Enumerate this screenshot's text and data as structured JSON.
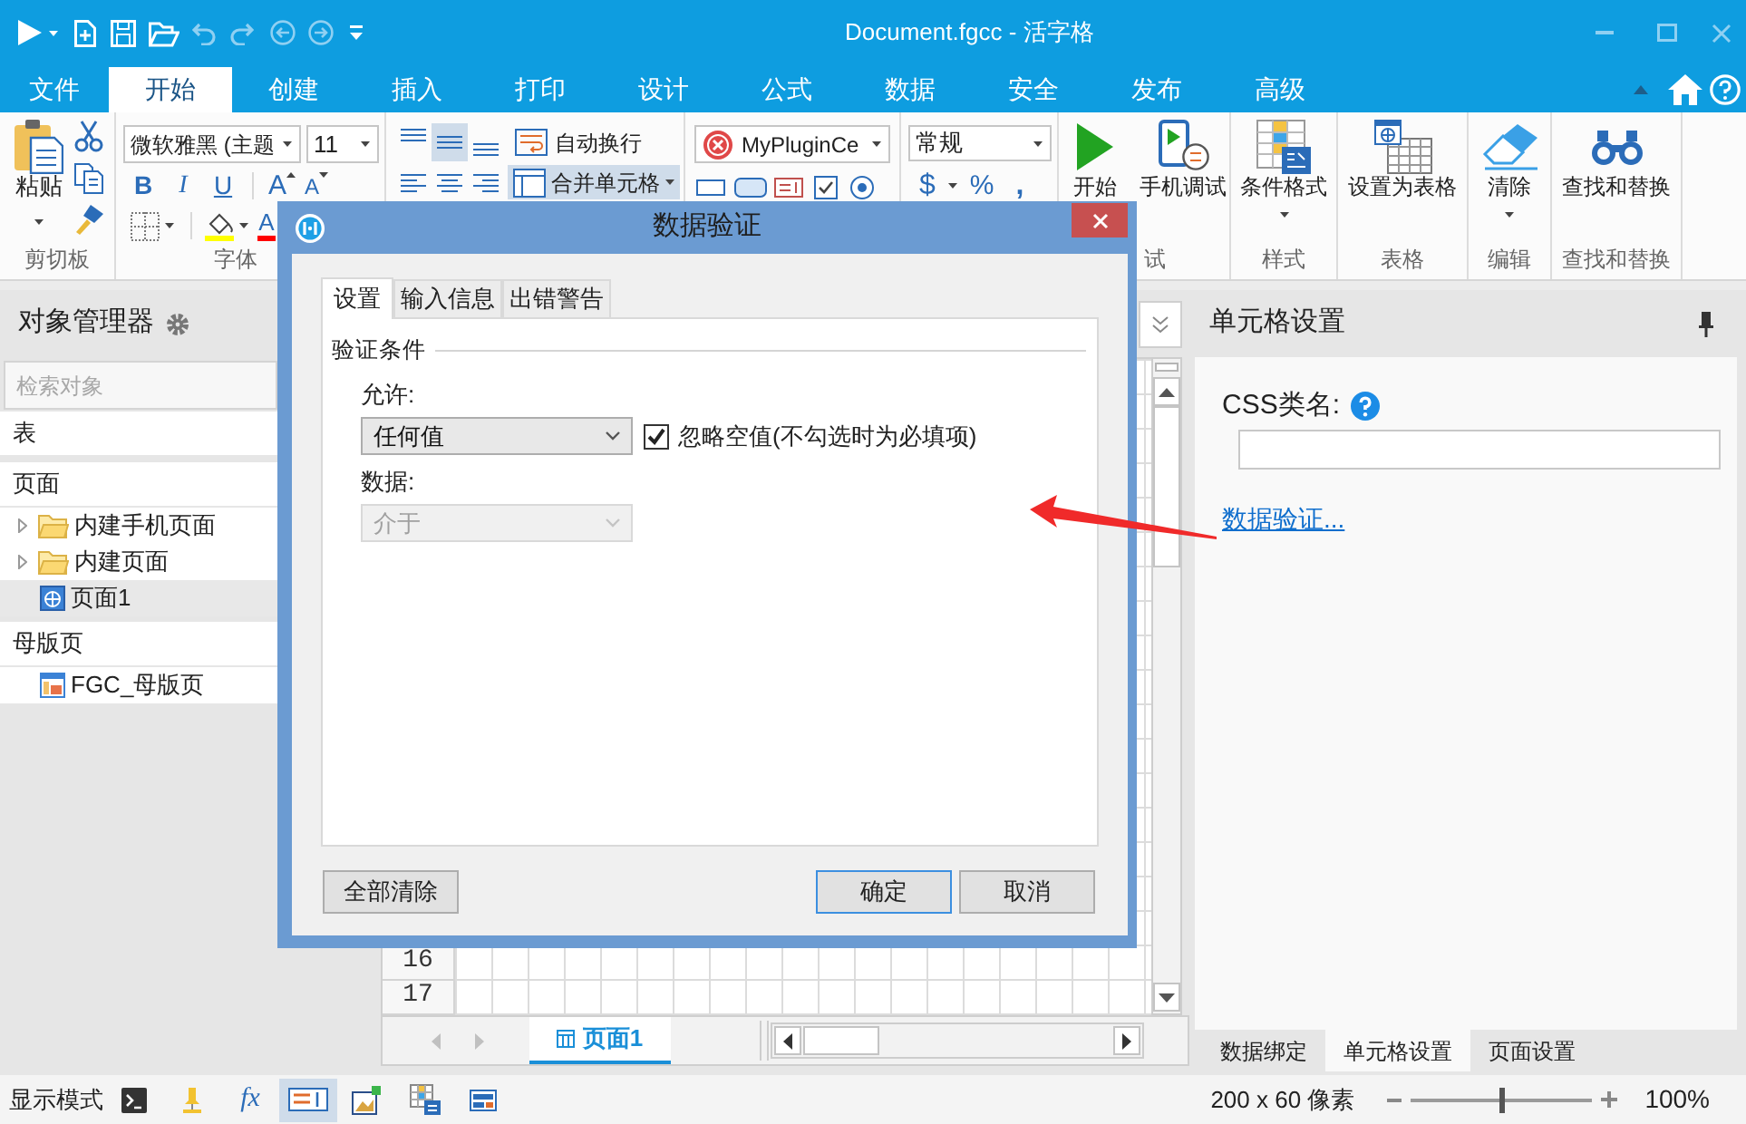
{
  "window": {
    "title": "Document.fgcc - 活字格"
  },
  "menu_tabs": [
    {
      "label": "文件",
      "selected": false
    },
    {
      "label": "开始",
      "selected": true
    },
    {
      "label": "创建",
      "selected": false
    },
    {
      "label": "插入",
      "selected": false
    },
    {
      "label": "打印",
      "selected": false
    },
    {
      "label": "设计",
      "selected": false
    },
    {
      "label": "公式",
      "selected": false
    },
    {
      "label": "数据",
      "selected": false
    },
    {
      "label": "安全",
      "selected": false
    },
    {
      "label": "发布",
      "selected": false
    },
    {
      "label": "高级",
      "selected": false
    }
  ],
  "ribbon": {
    "clipboard": {
      "paste": "粘贴",
      "group_label": "剪切板"
    },
    "font": {
      "font_name": "微软雅黑 (主题",
      "font_size": "11",
      "styles": [
        "B",
        "I",
        "U"
      ],
      "grow": "A",
      "shrink": "A",
      "font_color": "A",
      "group_label": "字体"
    },
    "alignment": {
      "vertical": [
        {
          "selected": false
        },
        {
          "selected": true
        },
        {
          "selected": false
        }
      ],
      "horizontal": [
        {
          "selected": false
        },
        {
          "selected": false
        },
        {
          "selected": false
        }
      ],
      "wrap_text": {
        "label": "自动换行",
        "selected": false
      },
      "merge_cells": {
        "label": "合并单元格",
        "selected": true
      }
    },
    "controls": {
      "plugin": "MyPluginCe"
    },
    "number": {
      "format": "常规",
      "symbols": [
        "$",
        "%",
        ","
      ]
    },
    "debug": {
      "start": "开始",
      "mobile": "手机调试",
      "group_label": "试"
    },
    "style": {
      "conditional_format": "条件格式",
      "group_label": "样式"
    },
    "table": {
      "set_as_table": "设置为表格",
      "group_label": "表格"
    },
    "edit": {
      "clear": "清除",
      "group_label": "编辑"
    },
    "find": {
      "find_replace": "查找和替换",
      "group_label": "查找和替换"
    }
  },
  "object_manager": {
    "title": "对象管理器",
    "search": {
      "placeholder": "检索对象"
    },
    "sections": [
      {
        "label": "表"
      },
      {
        "label": "页面",
        "items": [
          {
            "label": "内建手机页面",
            "kind": "folder",
            "expanded": false,
            "selected": false
          },
          {
            "label": "内建页面",
            "kind": "folder",
            "expanded": false,
            "selected": false
          },
          {
            "label": "页面1",
            "kind": "page",
            "selected": true
          }
        ]
      },
      {
        "label": "母版页",
        "items": [
          {
            "label": "FGC_母版页",
            "kind": "master",
            "selected": false
          }
        ]
      }
    ]
  },
  "sheet": {
    "rows": [
      {
        "header": "16"
      },
      {
        "header": "17"
      }
    ],
    "tabs": [
      {
        "label": "页面1",
        "selected": true
      }
    ]
  },
  "dialog": {
    "title": "数据验证",
    "tabs": [
      {
        "label": "设置",
        "selected": true
      },
      {
        "label": "输入信息",
        "selected": false
      },
      {
        "label": "出错警告",
        "selected": false
      }
    ],
    "section_title": "验证条件",
    "allow": {
      "label": "允许:",
      "value": "任何值",
      "disabled": false
    },
    "ignore_blank": {
      "label": "忽略空值(不勾选时为必填项)",
      "checked": true
    },
    "data": {
      "label": "数据:",
      "value": "介于",
      "disabled": true
    },
    "buttons": [
      {
        "label": "全部清除",
        "kind": "normal"
      },
      {
        "label": "确定",
        "kind": "default"
      },
      {
        "label": "取消",
        "kind": "normal"
      }
    ]
  },
  "cell_settings": {
    "title": "单元格设置",
    "css_class_label": "CSS类名:",
    "data_validation_link": "数据验证...",
    "tabs": [
      {
        "label": "数据绑定",
        "selected": false
      },
      {
        "label": "单元格设置",
        "selected": true
      },
      {
        "label": "页面设置",
        "selected": false
      }
    ]
  },
  "status_bar": {
    "mode_label": "显示模式",
    "modes": [
      {
        "kind": "console",
        "selected": false
      },
      {
        "kind": "marker",
        "selected": false
      },
      {
        "kind": "formula",
        "label": "fx",
        "selected": false
      },
      {
        "kind": "text",
        "selected": true
      },
      {
        "kind": "picture",
        "selected": false
      },
      {
        "kind": "table",
        "selected": false
      },
      {
        "kind": "form",
        "selected": false
      }
    ],
    "size": "200 x 60 像素",
    "zoom": {
      "level": 0.5,
      "reading": "100%"
    }
  }
}
